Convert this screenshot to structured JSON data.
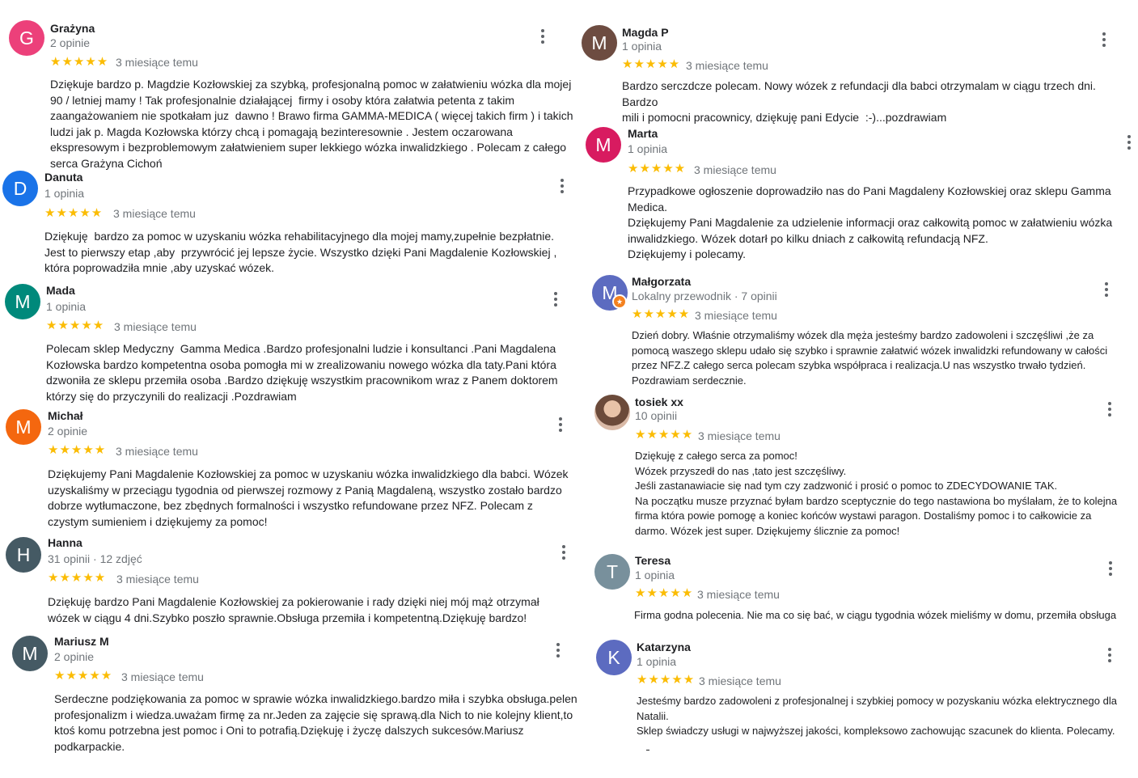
{
  "left": [
    {
      "name": "Grażyna",
      "meta": "2 opinie",
      "initial": "G",
      "color": "#ec407a",
      "time": "3 miesiące temu",
      "text": "Dziękuje bardzo p. Magdzie Kozłowskiej za szybką, profesjonalną pomoc w załatwieniu wózka dla mojej\n90 / letniej mamy ! Tak profesjonalnie działającej  firmy i osoby która załatwia petenta z takim\nzaangażowaniem nie spotkałam juz  dawno ! Brawo firma GAMMA-MEDICA ( więcej takich firm ) i takich\nludzi jak p. Magda Kozłowska którzy chcą i pomagają bezinteresownie . Jestem oczarowana\nekspresowym i bezproblemowym załatwieniem super lekkiego wózka inwalidzkiego . Polecam z całego\nserca Grażyna Cichoń"
    },
    {
      "name": "Danuta",
      "meta": "1 opinia",
      "initial": "D",
      "color": "#1a73e8",
      "time": "3 miesiące temu",
      "text": "Dziękuję  bardzo za pomoc w uzyskaniu wózka rehabilitacyjnego dla mojej mamy,zupełnie bezpłatnie.\nJest to pierwszy etap ,aby  przywrócić jej lepsze życie. Wszystko dzięki Pani Magdalenie Kozłowskiej ,\nktóra poprowadziła mnie ,aby uzyskać wózek."
    },
    {
      "name": "Mada",
      "meta": "1 opinia",
      "initial": "M",
      "color": "#00897b",
      "time": "3 miesiące temu",
      "text": "Polecam sklep Medyczny  Gamma Medica .Bardzo profesjonalni ludzie i konsultanci .Pani Magdalena\nKozłowska bardzo kompetentna osoba pomogła mi w zrealizowaniu nowego wózka dla taty.Pani która\ndzwoniła ze sklepu przemiła osoba .Bardzo dziękuję wszystkim pracownikom wraz z Panem doktorem\nktórzy się do przyczynili do realizacji .Pozdrawiam"
    },
    {
      "name": "Michał",
      "meta": "2 opinie",
      "initial": "M",
      "color": "#f4670f",
      "time": "3 miesiące temu",
      "text": "Dziękujemy Pani Magdalenie Kozłowskiej za pomoc w uzyskaniu wózka inwalidzkiego dla babci. Wózek\nuzyskaliśmy w przeciągu tygodnia od pierwszej rozmowy z Panią Magdaleną, wszystko zostało bardzo\ndobrze wytłumaczone, bez zbędnych formalności i wszystko refundowane przez NFZ. Polecam z\nczystym sumieniem i dziękujemy za pomoc!"
    },
    {
      "name": "Hanna",
      "meta": "31 opinii · 12 zdjęć",
      "initial": "H",
      "color": "#455a64",
      "time": "3 miesiące temu",
      "text": "Dziękuję bardzo Pani Magdalenie Kozłowskiej za pokierowanie i rady dzięki niej mój mąż otrzymał\nwózek w ciągu 4 dni.Szybko poszło sprawnie.Obsługa przemiła i kompetentną.Dziękuję bardzo!"
    },
    {
      "name": "Mariusz M",
      "meta": "2 opinie",
      "initial": "M",
      "color": "#455a64",
      "time": "3 miesiące temu",
      "text": "Serdeczne podziękowania za pomoc w sprawie wózka inwalidzkiego.bardzo miła i szybka obsługa.pelen\nprofesjonalizm i wiedza.uważam firmę za nr.Jeden za zajęcie się sprawą.dla Nich to nie kolejny klient,to\nktoś komu potrzebna jest pomoc i Oni to potrafią.Dziękuję i życzę dalszych sukcesów.Mariusz\npodkarpackie."
    }
  ],
  "right": [
    {
      "name": "Magda P",
      "meta": "1 opinia",
      "initial": "M",
      "color": "#6d4c41",
      "time": "3 miesiące temu",
      "text": "Bardzo serczdcze polecam. Nowy wózek z refundacji dla babci otrzymalam w ciągu trzech dni. Bardzo\nmili i pomocni pracownicy, dziękuję pani Edycie  :-)...pozdrawiam"
    },
    {
      "name": "Marta",
      "meta": "1 opinia",
      "initial": "M",
      "color": "#d81b60",
      "time": "3 miesiące temu",
      "text": "Przypadkowe ogłoszenie doprowadziło nas do Pani Magdaleny Kozłowskiej oraz sklepu Gamma\nMedica.\nDziękujemy Pani Magdalenie za udzielenie informacji oraz całkowitą pomoc w załatwieniu wózka\ninwalidzkiego. Wózek dotarł po kilku dniach z całkowitą refundacją NFZ.\nDziękujemy i polecamy."
    },
    {
      "name": "Małgorzata",
      "meta": "Lokalny przewodnik · 7 opinii",
      "initial": "M",
      "color": "#5c6bc0",
      "time": "3 miesiące temu",
      "text": "Dzień dobry. Właśnie otrzymaliśmy wózek dla męża jesteśmy bardzo zadowoleni i szczęśliwi ,że za\npomocą waszego sklepu udało się szybko i sprawnie załatwić wózek inwalidzki refundowany w całości\nprzez NFZ.Z całego serca polecam szybka współpraca i realizacja.U nas wszystko trwało tydzień.\nPozdrawiam serdecznie."
    },
    {
      "name": "tosiek xx",
      "meta": "10 opinii",
      "initial": "",
      "color": "#8d6e63",
      "time": "3 miesiące temu",
      "text": "Dziękuję z całego serca za pomoc!\nWózek przyszedł do nas ,tato jest szczęśliwy.\nJeśli zastanawiacie się nad tym czy zadzwonić i prosić o pomoc to ZDECYDOWANIE TAK.\nNa początku musze przyznać byłam bardzo sceptycznie do tego nastawiona bo myślałam, że to kolejna\nfirma która powie pomogę a koniec końców wystawi paragon. Dostaliśmy pomoc i to całkowicie za\ndarmo. Wózek jest super. Dziękujemy ślicznie za pomoc!"
    },
    {
      "name": "Teresa",
      "meta": "1 opinia",
      "initial": "T",
      "color": "#78909c",
      "time": "3 miesiące temu",
      "text": "Firma godna polecenia. Nie ma co się bać, w ciągu tygodnia wózek mieliśmy w domu, przemiła obsługa"
    },
    {
      "name": "Katarzyna",
      "meta": "1 opinia",
      "initial": "K",
      "color": "#5c6bc0",
      "time": "3 miesiące temu",
      "text": "Jesteśmy bardzo zadowoleni z profesjonalnej i szybkiej pomocy w pozyskaniu wózka elektrycznego dla\nNatalii.\nSklep świadczy usługi w najwyższej jakości, kompleksowo zachowując szacunek do klienta. Polecamy."
    }
  ],
  "stars": "★★★★★"
}
